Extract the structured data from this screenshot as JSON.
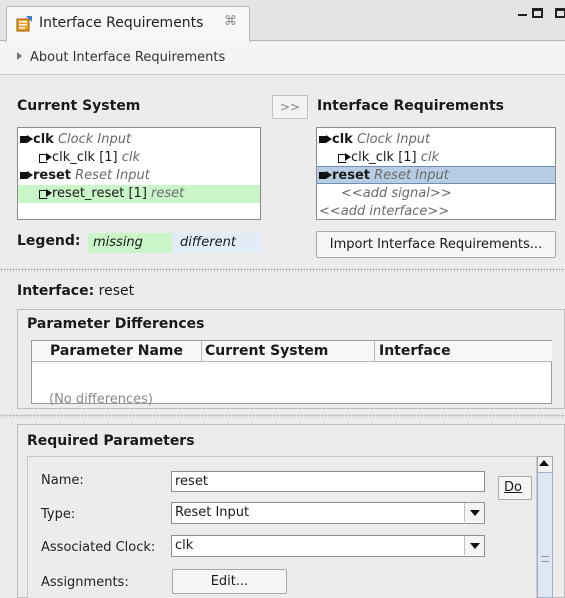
{
  "tab": {
    "title": "Interface Requirements",
    "close": "⌘"
  },
  "about": {
    "label": "About Interface Requirements"
  },
  "top_panel": {
    "current_system_heading": "Current System",
    "sync_button": ">>",
    "interface_requirements_heading": "Interface Requirements",
    "current_list": [
      {
        "name": "clk",
        "desc": "Clock Input"
      },
      {
        "name": "clk_clk [1]",
        "desc": "clk"
      },
      {
        "name": "reset",
        "desc": "Reset Input"
      },
      {
        "name": "reset_reset [1]",
        "desc": "reset"
      }
    ],
    "iface_list": [
      {
        "name": "clk",
        "desc": "Clock Input"
      },
      {
        "name": "clk_clk [1]",
        "desc": "clk"
      },
      {
        "name": "reset",
        "desc": "Reset Input"
      },
      {
        "add_signal": "<<add signal>>"
      },
      {
        "add_interface": "<<add interface>>"
      }
    ],
    "legend_label": "Legend:",
    "legend_missing": "missing",
    "legend_different": "different",
    "import_button": "Import Interface Requirements..."
  },
  "interface": {
    "label": "Interface:",
    "value": "reset"
  },
  "param_diff": {
    "title": "Parameter Differences",
    "columns": [
      "Parameter Name",
      "Current System",
      "Interface"
    ],
    "empty_text": "(No differences)"
  },
  "required": {
    "title": "Required Parameters",
    "name_label": "Name:",
    "name_value": "reset",
    "type_label": "Type:",
    "type_value": "Reset Input",
    "clock_label": "Associated Clock:",
    "clock_value": "clk",
    "assign_label": "Assignments:",
    "edit_button": "Edit...",
    "doc_button": "Do"
  },
  "colors": {
    "missing": "#c9f5c9",
    "different": "#e2ecf7",
    "selected": "#b7cde4"
  }
}
